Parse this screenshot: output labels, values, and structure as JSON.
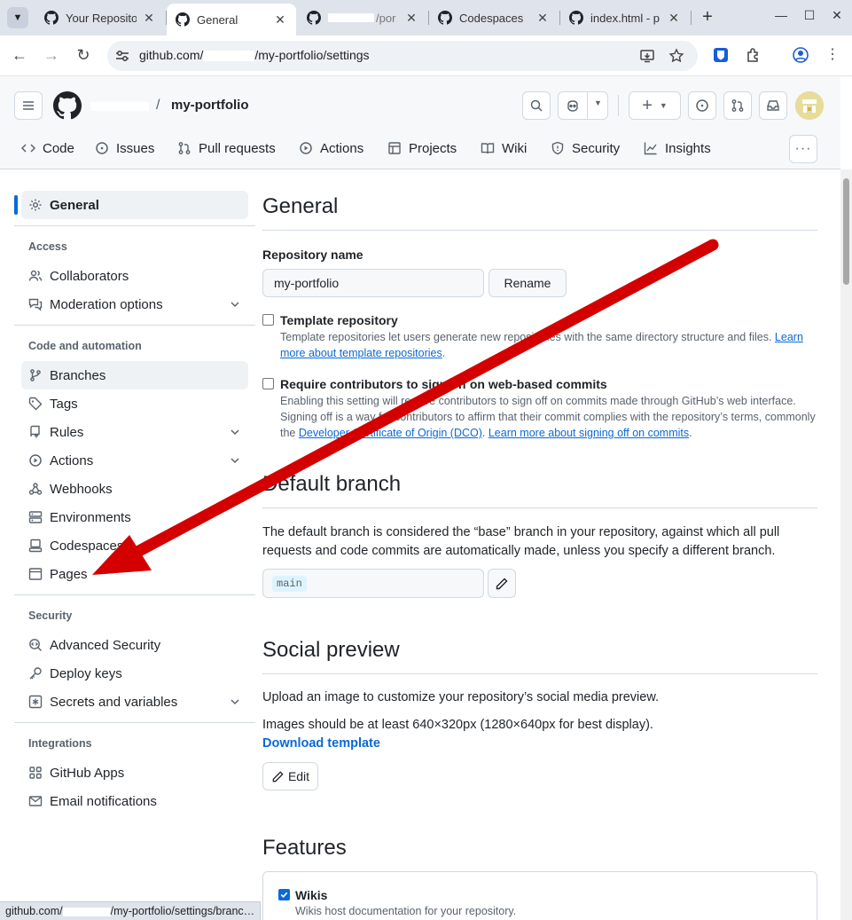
{
  "browser": {
    "tabs": [
      {
        "title": "Your Repositories",
        "active": false
      },
      {
        "title": "General",
        "active": true
      },
      {
        "title": "/por",
        "active": false
      },
      {
        "title": "Codespaces",
        "active": false
      },
      {
        "title": "index.html - p",
        "active": false
      }
    ],
    "url": {
      "prefix": "github.com/",
      "suffix": "/my-portfolio/settings"
    },
    "status_url": {
      "prefix": "github.com/",
      "suffix": "/my-portfolio/settings/branc…"
    }
  },
  "header": {
    "repo_name": "my-portfolio",
    "separator": "/"
  },
  "repo_nav": [
    {
      "label": "Code",
      "icon": "code-icon"
    },
    {
      "label": "Issues",
      "icon": "issue-icon"
    },
    {
      "label": "Pull requests",
      "icon": "pull-request-icon"
    },
    {
      "label": "Actions",
      "icon": "play-icon"
    },
    {
      "label": "Projects",
      "icon": "table-icon"
    },
    {
      "label": "Wiki",
      "icon": "book-icon"
    },
    {
      "label": "Security",
      "icon": "shield-icon"
    },
    {
      "label": "Insights",
      "icon": "graph-icon"
    }
  ],
  "sidebar": {
    "general": "General",
    "access_heading": "Access",
    "access": [
      "Collaborators",
      "Moderation options"
    ],
    "code_heading": "Code and automation",
    "code": [
      "Branches",
      "Tags",
      "Rules",
      "Actions",
      "Webhooks",
      "Environments",
      "Codespaces",
      "Pages"
    ],
    "security_heading": "Security",
    "security": [
      "Advanced Security",
      "Deploy keys",
      "Secrets and variables"
    ],
    "integrations_heading": "Integrations",
    "integrations": [
      "GitHub Apps",
      "Email notifications"
    ]
  },
  "main": {
    "general_title": "General",
    "repo_name_label": "Repository name",
    "repo_name_value": "my-portfolio",
    "rename_label": "Rename",
    "template_label": "Template repository",
    "template_desc": "Template repositories let users generate new repositories with the same directory structure and files.",
    "template_link": "Learn more about template repositories",
    "signoff_label": "Require contributors to sign off on web-based commits",
    "signoff_desc": "Enabling this setting will require contributors to sign off on commits made through GitHub’s web interface. Signing off is a way for contributors to affirm that their commit complies with the repository’s terms, commonly the",
    "signoff_link1": "Developer Certificate of Origin (DCO)",
    "signoff_link2": "Learn more about signing off on commits",
    "default_branch_title": "Default branch",
    "default_branch_desc": "The default branch is considered the “base” branch in your repository, against which all pull requests and code commits are automatically made, unless you specify a different branch.",
    "default_branch_value": "main",
    "social_title": "Social preview",
    "social_desc": "Upload an image to customize your repository’s social media preview.",
    "social_size": "Images should be at least 640×320px (1280×640px for best display).",
    "download_template": "Download template",
    "edit_label": "Edit",
    "features_title": "Features",
    "wikis_label": "Wikis",
    "wikis_desc": "Wikis host documentation for your repository."
  },
  "colors": {
    "accent": "#0969da",
    "annotation_arrow": "#d40000"
  }
}
